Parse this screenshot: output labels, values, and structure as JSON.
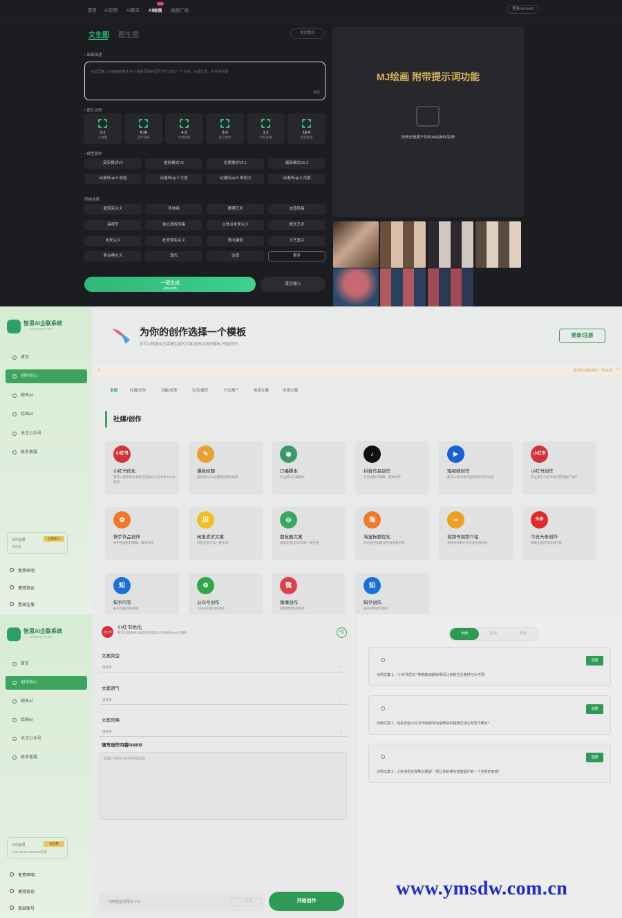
{
  "s1": {
    "nav": [
      "首页",
      "AI应用",
      "AI聊天",
      "AI绘画",
      "绘画广场"
    ],
    "active_nav": "AI绘画",
    "login": "登录/yemsdl",
    "tabs": [
      "文生图",
      "图生图"
    ],
    "follow": "关注我们",
    "prompt_label": "• 画面描述",
    "prompt_placeholder": "在这里输入对画面的描述,多个关键词请用逗号分开,比如:一个女孩、马尾长发、粉色连衣裙",
    "prompt_clear": "清空",
    "size_label": "• 图片比例",
    "ratios": [
      {
        "v": "1:1",
        "d": "头像图"
      },
      {
        "v": "9:16",
        "d": "宣传海报"
      },
      {
        "v": "4:3",
        "d": "文章配图"
      },
      {
        "v": "3:4",
        "d": "社交媒体"
      },
      {
        "v": "1:2",
        "d": "手机屏幕"
      },
      {
        "v": "16:9",
        "d": "桌面壁纸"
      }
    ],
    "model_label": "• 模型版本",
    "models": [
      "真实模式V4",
      "虚拟模式V5",
      "优质模式V5.1",
      "最新模式V5.2",
      "动漫风niji 5 原始",
      "动漫风niji 5 可爱",
      "动漫风niji 5 表现力",
      "动漫风niji 5 风景"
    ],
    "style_label": "风格选择",
    "styles": [
      "超现实主义",
      "色块画",
      "赛博艺术",
      "波普风格",
      "高细节",
      "独立游戏风格",
      "立体派未来主义",
      "概念艺术",
      "未来主义",
      "杜奇现实主义",
      "室内建筑",
      "文艺复兴",
      "新古典主义",
      "现代",
      "动漫",
      "更多"
    ],
    "generate": "一键生成",
    "generate_sub": "(消耗3次数)",
    "clear_input": "清空输入",
    "preview_title": "MJ绘画 附带提示词功能",
    "preview_sub": "快来创造属于你的AI绘画作品吧!"
  },
  "brand": {
    "name": "智思AI企联系统",
    "sub": "ASSISTANT"
  },
  "sidebar": [
    "首页",
    "创作中心",
    "聊天AI",
    "绘画AI",
    "关注公众号",
    "联系客服"
  ],
  "s2": {
    "vip_title": "VIP会员",
    "vip_btn": "立即加入",
    "vip_sub": "未开通",
    "footer": [
      "免责申明",
      "使用协议",
      "登录注册"
    ],
    "hero_title": "为你的创作选择一个模板",
    "hero_sub": "你可以根据自己需要生成的文案,选择合适的模板,开始创作!",
    "login": "登录/注册",
    "notice": "智思AI企联系统 一款企业",
    "categories": [
      "全部",
      "社媒/创作",
      "功能/效率",
      "生活/娱乐",
      "行业推广",
      "电商文案",
      "市场文案"
    ],
    "section": "社媒/创作",
    "cards": [
      {
        "t": "小红书优化",
        "d": "我可以帮你将文本改写成类似小红书的 Emoji 风格",
        "icon": "小红书",
        "c": "#d4323c"
      },
      {
        "t": "爆款标题",
        "d": "短视频/公众号爆款吸睛的标题",
        "icon": "✎",
        "c": "#e8a030"
      },
      {
        "t": "口播脚本",
        "d": "专业撰写口播脚本",
        "icon": "◉",
        "c": "#3a9a6a"
      },
      {
        "t": "抖音作品创作",
        "d": "抖音视频口播稿、脚本创作",
        "icon": "♪",
        "c": "#111111"
      },
      {
        "t": "短视频创作",
        "d": "我可以帮你进行短视频的创作文案",
        "icon": "▶",
        "c": "#1a5fd8"
      },
      {
        "t": "小红书创作",
        "d": "专业基于小红书进行营销推广创作",
        "icon": "小红书",
        "c": "#d4323c"
      },
      {
        "t": "快手作品创作",
        "d": "快手短视频口播稿、脚本创作",
        "icon": "✿",
        "c": "#f07a2a"
      },
      {
        "t": "闲鱼卖货文案",
        "d": "闲鱼卖货文案一键生成",
        "icon": "田",
        "c": "#f0c020"
      },
      {
        "t": "朋友圈文案",
        "d": "发朋友圈/卖货/日常一键生成",
        "icon": "◎",
        "c": "#3aa860"
      },
      {
        "t": "淘宝标题优化",
        "d": "优化淘宝标题,提升搜索展示率",
        "icon": "淘",
        "c": "#f07a2a"
      },
      {
        "t": "视频号视频介绍",
        "d": "视频号视频介绍文本生成指导",
        "icon": "∞",
        "c": "#f0a020"
      },
      {
        "t": "今日头条创作",
        "d": "根据主题创作优质内容",
        "icon": "头条",
        "c": "#e02a2a"
      },
      {
        "t": "知乎问答",
        "d": "知乎风格创作神器",
        "icon": "知",
        "c": "#1a6fd8"
      },
      {
        "t": "公众号创作",
        "d": "公众号内容创作助手",
        "icon": "♻",
        "c": "#2ea84a"
      },
      {
        "t": "微博创作",
        "d": "微博爆博创作助手",
        "icon": "微",
        "c": "#e0404a"
      },
      {
        "t": "知乎创作",
        "d": "知乎内容创作助手",
        "icon": "知",
        "c": "#1a6fd8"
      }
    ]
  },
  "s3": {
    "vip_title": "VIP会员",
    "vip_btn": "去续费",
    "vip_date": "2029-12-31 00:00:00到期",
    "footer": [
      "免责申明",
      "使用协议",
      "退出账号"
    ],
    "form_icon": "小红书",
    "form_title": "小红书优化",
    "form_sub": "我可以帮你将文本改写成类似小红书的 Emoji 风格",
    "fields": [
      {
        "label": "文案类型",
        "ph": "请选择"
      },
      {
        "label": "文案语气",
        "ph": "请选择"
      },
      {
        "label": "文案风格",
        "ph": "请选择"
      }
    ],
    "content_label": "填写创作内容0/4000",
    "content_ph": "请输入你的小红书作品标题",
    "model": "切换模型(智思AI 3.5)",
    "qty": "1",
    "start": "开始创作",
    "segments": [
      "示例",
      "本次",
      "历史"
    ],
    "examples": [
      "示例文案:1、\"小红书优化\" 神奇魔法解锁!瞬间让你的生活变得与众不同!",
      "示例文案:2、快来体验小红书升级版!新功能带来的极致优化让你爱不释手!",
      "示例文案:3、小红书优化攻略大揭秘!一招让你的美妆技能提升到一个全新的高度!"
    ],
    "select_label": "选择",
    "watermark": "www.ymsdw.com.cn"
  }
}
